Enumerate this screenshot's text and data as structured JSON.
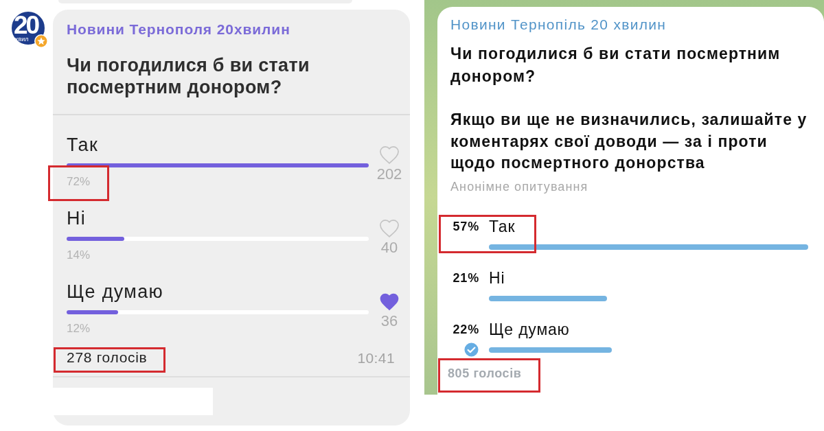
{
  "left_poll": {
    "avatar": {
      "number": "20",
      "caption": "хвил"
    },
    "channel": "Новини Тернополя 20хвилин",
    "question": "Чи погодилися б ви стати посмертним донором?",
    "options": [
      {
        "label": "Так",
        "level": 1,
        "percent": "72%",
        "count": "202",
        "selected": false,
        "highlighted": true
      },
      {
        "label": "Ні",
        "level": 0.19,
        "percent": "14%",
        "count": "40",
        "selected": false,
        "highlighted": false
      },
      {
        "label": "Ще думаю",
        "level": 0.17,
        "percent": "12%",
        "count": "36",
        "selected": true,
        "highlighted": false
      }
    ],
    "total_votes": {
      "text": "278 голосів",
      "highlighted": true
    },
    "time": "10:41"
  },
  "right_poll": {
    "channel": "Новини Тернопіль 20 хвилин",
    "question": "Чи погодилися б ви стати посмертним донором?",
    "note": "Якщо ви ще не визначились, залишайте у\nкоментарях свої доводи — за і проти\nщодо посмертного донорства",
    "poll_type": "Анонімне опитування",
    "options": [
      {
        "percent": "57%",
        "label": "Так",
        "level": 1,
        "selected": false,
        "highlighted": true
      },
      {
        "percent": "21%",
        "label": "Ні",
        "level": 0.37,
        "selected": false,
        "highlighted": false
      },
      {
        "percent": "22%",
        "label": "Ще думаю",
        "level": 0.385,
        "selected": true,
        "highlighted": false
      }
    ],
    "total_votes": {
      "text": "805 голосів",
      "highlighted": true
    }
  }
}
